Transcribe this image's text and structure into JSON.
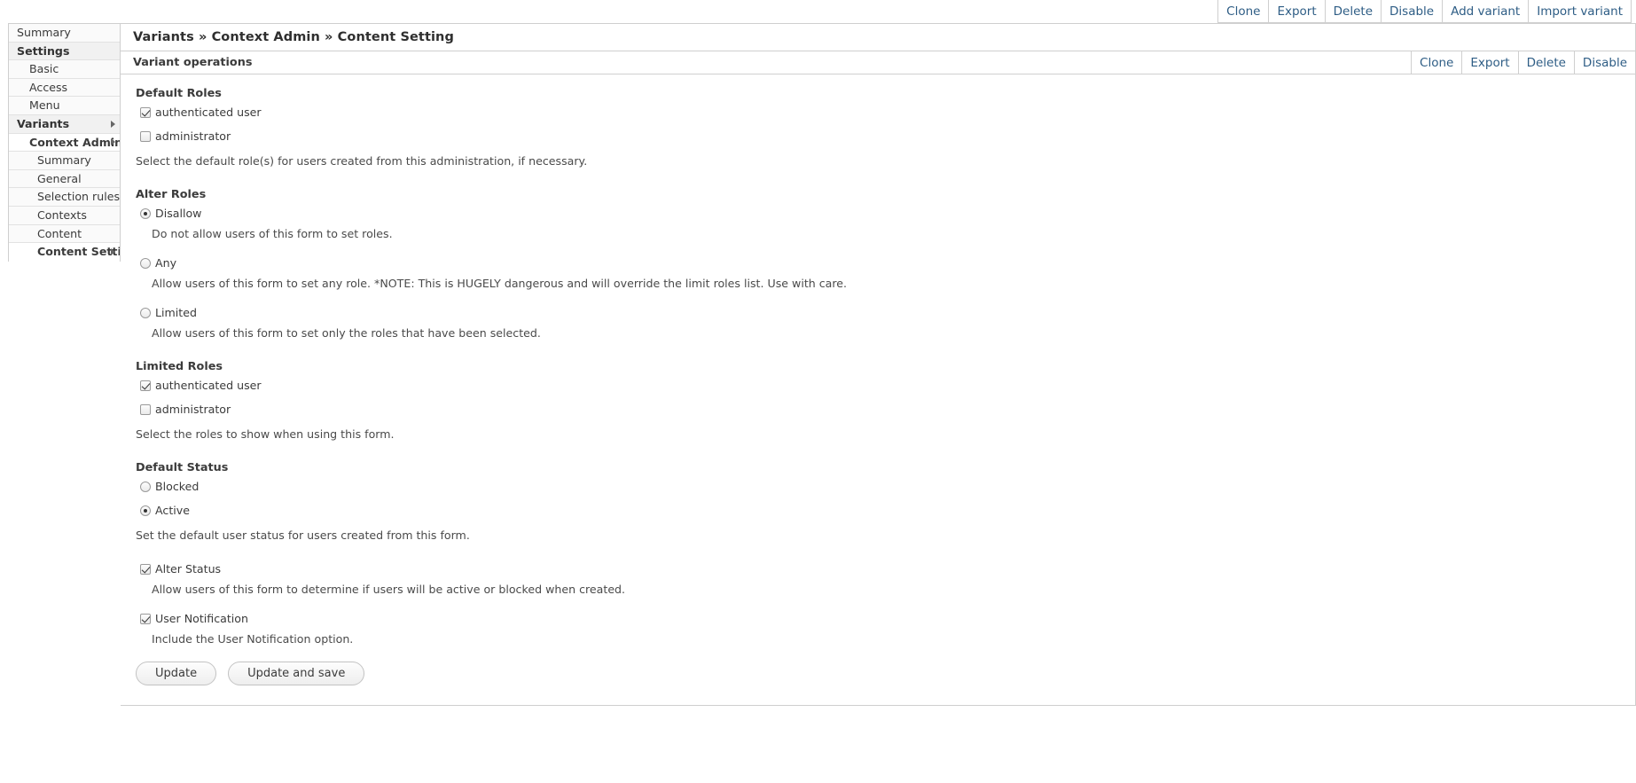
{
  "top_operations": [
    {
      "label": "Clone"
    },
    {
      "label": "Export"
    },
    {
      "label": "Delete"
    },
    {
      "label": "Disable"
    },
    {
      "label": "Add variant"
    },
    {
      "label": "Import variant"
    }
  ],
  "sidebar": {
    "items": [
      {
        "label": "Summary",
        "level": 0,
        "group": false,
        "bold": false,
        "arrow": false,
        "style": "plain"
      },
      {
        "label": "Settings",
        "level": 0,
        "group": true,
        "bold": true,
        "arrow": false,
        "style": "group"
      },
      {
        "label": "Basic",
        "level": 1,
        "group": false,
        "bold": false,
        "arrow": false,
        "style": "plain"
      },
      {
        "label": "Access",
        "level": 1,
        "group": false,
        "bold": false,
        "arrow": false,
        "style": "plain"
      },
      {
        "label": "Menu",
        "level": 1,
        "group": false,
        "bold": false,
        "arrow": false,
        "style": "plain"
      },
      {
        "label": "Variants",
        "level": 0,
        "group": true,
        "bold": true,
        "arrow": true,
        "style": "group"
      },
      {
        "label": "Context Admin",
        "level": 1,
        "group": false,
        "bold": true,
        "arrow": true,
        "style": "white"
      },
      {
        "label": "Summary",
        "level": 2,
        "group": false,
        "bold": false,
        "arrow": false,
        "style": "plain"
      },
      {
        "label": "General",
        "level": 2,
        "group": false,
        "bold": false,
        "arrow": false,
        "style": "plain"
      },
      {
        "label": "Selection rules",
        "level": 2,
        "group": false,
        "bold": false,
        "arrow": false,
        "style": "plain"
      },
      {
        "label": "Contexts",
        "level": 2,
        "group": false,
        "bold": false,
        "arrow": false,
        "style": "plain"
      },
      {
        "label": "Content",
        "level": 2,
        "group": false,
        "bold": false,
        "arrow": false,
        "style": "plain"
      },
      {
        "label": "Content Setting",
        "level": 2,
        "group": false,
        "bold": true,
        "arrow": true,
        "style": "white"
      }
    ]
  },
  "page": {
    "title": "Variants » Context Admin » Content Setting"
  },
  "section": {
    "title": "Variant operations",
    "operations": [
      {
        "label": "Clone"
      },
      {
        "label": "Export"
      },
      {
        "label": "Delete"
      },
      {
        "label": "Disable"
      }
    ]
  },
  "form": {
    "default_roles": {
      "legend": "Default Roles",
      "options": [
        {
          "label": "authenticated user",
          "checked": true
        },
        {
          "label": "administrator",
          "checked": false
        }
      ],
      "description": "Select the default role(s) for users created from this administration, if necessary."
    },
    "alter_roles": {
      "legend": "Alter Roles",
      "options": [
        {
          "label": "Disallow",
          "checked": true,
          "description": "Do not allow users of this form to set roles."
        },
        {
          "label": "Any",
          "checked": false,
          "description": "Allow users of this form to set any role. *NOTE: This is HUGELY dangerous and will override the limit roles list. Use with care."
        },
        {
          "label": "Limited",
          "checked": false,
          "description": "Allow users of this form to set only the roles that have been selected."
        }
      ]
    },
    "limited_roles": {
      "legend": "Limited Roles",
      "options": [
        {
          "label": "authenticated user",
          "checked": true
        },
        {
          "label": "administrator",
          "checked": false
        }
      ],
      "description": "Select the roles to show when using this form."
    },
    "default_status": {
      "legend": "Default Status",
      "options": [
        {
          "label": "Blocked",
          "checked": false
        },
        {
          "label": "Active",
          "checked": true
        }
      ],
      "description": "Set the default user status for users created from this form."
    },
    "alter_status": {
      "label": "Alter Status",
      "checked": true,
      "description": "Allow users of this form to determine if users will be active or blocked when created."
    },
    "user_notification": {
      "label": "User Notification",
      "checked": true,
      "description": "Include the User Notification option."
    },
    "buttons": [
      {
        "label": "Update"
      },
      {
        "label": "Update and save"
      }
    ]
  },
  "colors": {
    "link": "#2e5d85",
    "border": "#cfcfcf",
    "text": "#3b3b3b"
  }
}
